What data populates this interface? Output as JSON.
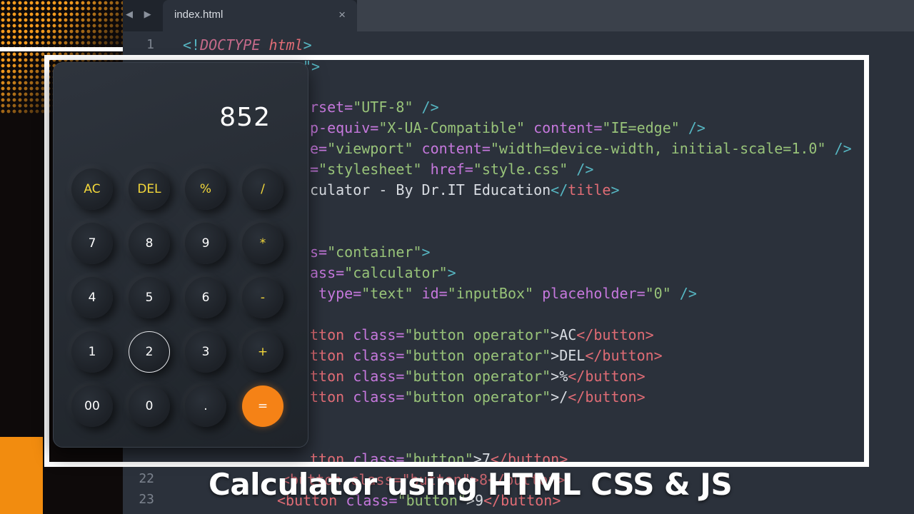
{
  "editor": {
    "tab_title": "index.html",
    "tab_close": "×",
    "nav_arrows": "◀ ▶",
    "line_numbers": {
      "l1": "1",
      "l22": "22",
      "l23": "23"
    },
    "lines": {
      "l1_open": "<!",
      "l1_doctype": "DOCTYPE",
      "l1_html": "html",
      "l1_close": ">",
      "l2": "\">",
      "l5_a": "rset=",
      "l5_b": "\"UTF-8\"",
      "l5_c": " />",
      "l6_a": "p-equiv=",
      "l6_b": "\"X-UA-Compatible\"",
      "l6_c": " content=",
      "l6_d": "\"IE=edge\"",
      "l6_e": " />",
      "l7_a": "e=",
      "l7_b": "\"viewport\"",
      "l7_c": " content=",
      "l7_d": "\"width=device-width, initial-scale=1.0\"",
      "l7_e": " />",
      "l8_a": "=",
      "l8_b": "\"stylesheet\"",
      "l8_c": " href=",
      "l8_d": "\"style.css\"",
      "l8_e": " />",
      "l9_a": "culator - By Dr.IT Education",
      "l9_b": "</",
      "l9_c": "title",
      "l9_d": ">",
      "l12_a": "s=",
      "l12_b": "\"container\"",
      "l12_c": ">",
      "l13_a": "ass=",
      "l13_b": "\"calculator\"",
      "l13_c": ">",
      "l14_a": " type=",
      "l14_b": "\"text\"",
      "l14_c": " id=",
      "l14_d": "\"inputBox\"",
      "l14_e": " placeholder=",
      "l14_f": "\"0\"",
      "l14_g": " />",
      "l16_a": "tton",
      "l16_b": " class=",
      "l16_c": "\"button operator\"",
      "l16_d": ">AC",
      "l16_e": "</button>",
      "l17_d": ">DEL",
      "l18_d": ">%",
      "l19_d": ">/",
      "l21_a": "tton",
      "l21_b": " class=",
      "l21_c": "\"button\"",
      "l21_d": ">7",
      "l21_e": "</button>",
      "l22_code": "<button class=\"button\">8</button>",
      "l23_a": "<button",
      "l23_b": " class=",
      "l23_c": "\"button\"",
      "l23_d": ">9",
      "l23_e": "</button>"
    }
  },
  "calculator": {
    "display": "852",
    "rows": [
      [
        "AC",
        "DEL",
        "%",
        "/"
      ],
      [
        "7",
        "8",
        "9",
        "*"
      ],
      [
        "4",
        "5",
        "6",
        "-"
      ],
      [
        "1",
        "2",
        "3",
        "+"
      ],
      [
        "00",
        "0",
        ".",
        "="
      ]
    ]
  },
  "caption": "Calculator using HTML CSS & JS",
  "colors": {
    "accent_orange": "#f58216",
    "operator_yellow": "#f5d93a",
    "editor_bg": "#2b313b"
  }
}
